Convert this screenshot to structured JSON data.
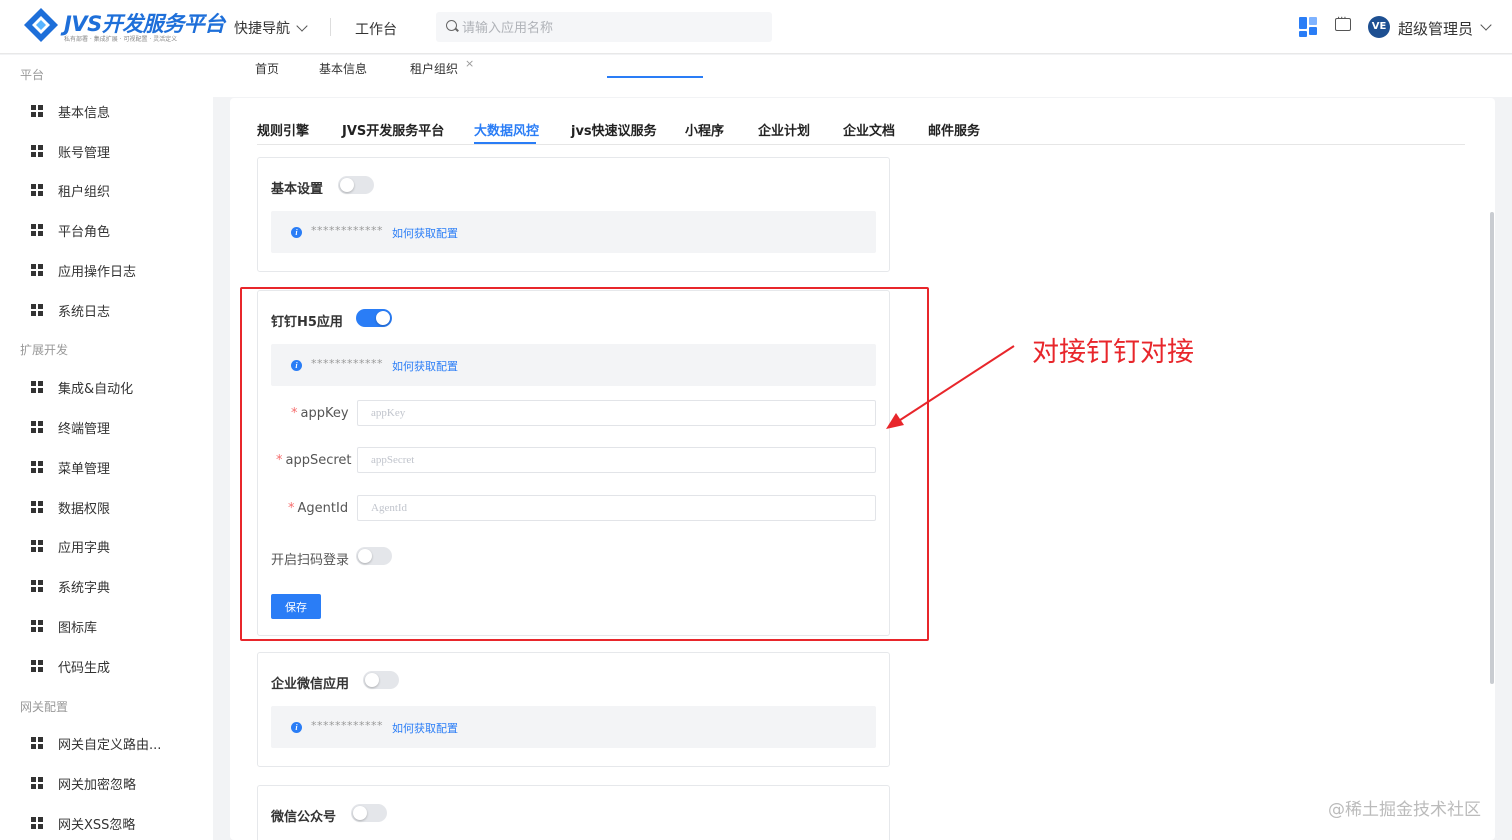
{
  "header": {
    "logo_title": "JVS开发服务平台",
    "logo_subtitle": "私有部署 · 集成扩展 · 可视配置 · 灵活定义",
    "quick_nav_label": "快捷导航",
    "workbench_label": "工作台",
    "search_placeholder": "请输入应用名称",
    "avatar_text": "VE",
    "user_name": "超级管理员"
  },
  "sidebar": {
    "groups": [
      {
        "label": "平台",
        "items": [
          "基本信息",
          "账号管理",
          "租户组织",
          "平台角色",
          "应用操作日志",
          "系统日志"
        ]
      },
      {
        "label": "扩展开发",
        "items": [
          "集成&自动化",
          "终端管理",
          "菜单管理",
          "数据权限",
          "应用字典",
          "系统字典",
          "图标库",
          "代码生成"
        ]
      },
      {
        "label": "网关配置",
        "items": [
          "网关自定义路由...",
          "网关加密忽略",
          "网关XSS忽略"
        ]
      }
    ]
  },
  "page_tabs": {
    "items": [
      "首页",
      "基本信息",
      "租户组织"
    ],
    "active": "租户组织",
    "close_glyph": "×"
  },
  "sub_tabs": {
    "items": [
      "规则引擎",
      "JVS开发服务平台",
      "大数据风控",
      "jvs快速议服务",
      "小程序",
      "企业计划",
      "企业文档",
      "邮件服务"
    ],
    "active": "大数据风控"
  },
  "cards": {
    "basic": {
      "title": "基本设置",
      "enabled": false,
      "mask": "************",
      "link": "如何获取配置"
    },
    "dingtalk": {
      "title": "钉钉H5应用",
      "enabled": true,
      "mask": "************",
      "link": "如何获取配置",
      "fields": [
        {
          "label": "appKey",
          "placeholder": "appKey",
          "value": "",
          "required": true
        },
        {
          "label": "appSecret",
          "placeholder": "appSecret",
          "value": "",
          "required": true
        },
        {
          "label": "AgentId",
          "placeholder": "AgentId",
          "value": "",
          "required": true
        }
      ],
      "scan_login_label": "开启扫码登录",
      "scan_login_enabled": false,
      "save_label": "保存"
    },
    "wecom": {
      "title": "企业微信应用",
      "enabled": false,
      "mask": "************",
      "link": "如何获取配置"
    },
    "wechat_mp": {
      "title": "微信公众号",
      "enabled": false
    }
  },
  "annotation": {
    "text": "对接钉钉对接",
    "color": "#e8262b"
  },
  "watermark": "@稀土掘金技术社区",
  "colors": {
    "accent": "#2a7df6",
    "annotation_red": "#e8262b",
    "required": "#f56c6c"
  }
}
